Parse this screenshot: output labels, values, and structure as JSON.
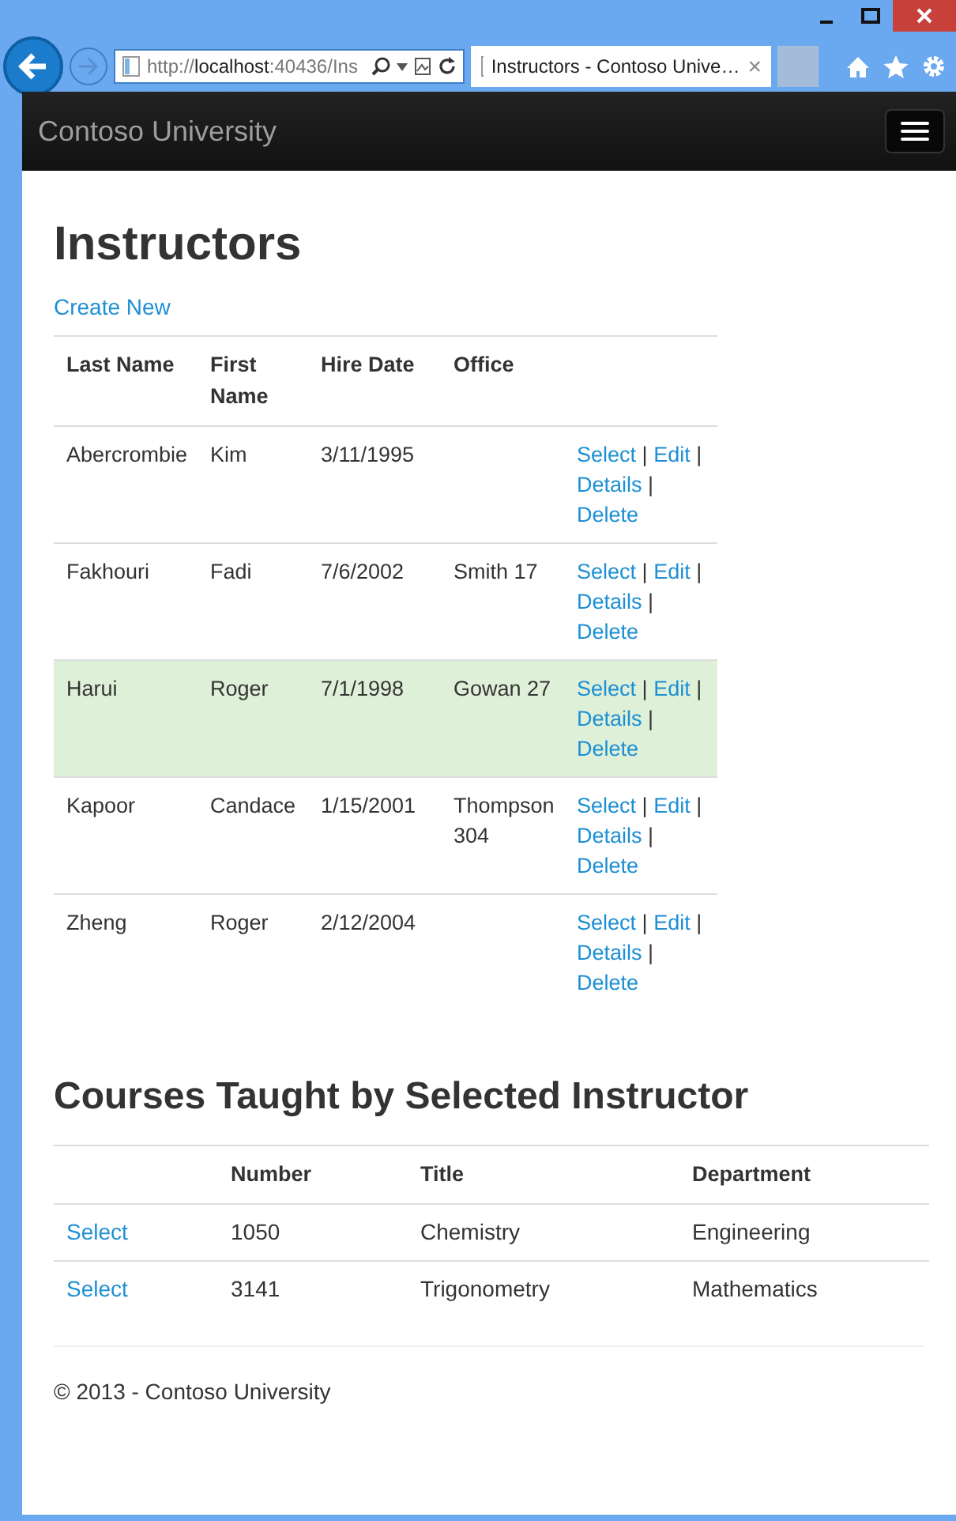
{
  "browser": {
    "address": "http://**localhost**:40436/Ins",
    "tab_title": "Instructors - Contoso Unive…",
    "tab_close": "×"
  },
  "navbar": {
    "brand": "Contoso University"
  },
  "page": {
    "title": "Instructors",
    "create_link": "Create New",
    "instructors": {
      "columns": [
        "Last Name",
        "First Name",
        "Hire Date",
        "Office"
      ],
      "separator": "|",
      "rows": [
        {
          "cells": [
            "Abercrombie",
            "Kim",
            "3/11/1995",
            ""
          ],
          "actions": [
            "Select",
            "Edit",
            "Details",
            "Delete"
          ],
          "selected": false
        },
        {
          "cells": [
            "Fakhouri",
            "Fadi",
            "7/6/2002",
            "Smith 17"
          ],
          "actions": [
            "Select",
            "Edit",
            "Details",
            "Delete"
          ],
          "selected": false
        },
        {
          "cells": [
            "Harui",
            "Roger",
            "7/1/1998",
            "Gowan 27"
          ],
          "actions": [
            "Select",
            "Edit",
            "Details",
            "Delete"
          ],
          "selected": true
        },
        {
          "cells": [
            "Kapoor",
            "Candace",
            "1/15/2001",
            "Thompson 304"
          ],
          "actions": [
            "Select",
            "Edit",
            "Details",
            "Delete"
          ],
          "selected": false
        },
        {
          "cells": [
            "Zheng",
            "Roger",
            "2/12/2004",
            ""
          ],
          "actions": [
            "Select",
            "Edit",
            "Details",
            "Delete"
          ],
          "selected": false
        }
      ]
    },
    "courses_title": "Courses Taught by Selected Instructor",
    "courses": {
      "columns": [
        "",
        "Number",
        "Title",
        "Department"
      ],
      "rows": [
        {
          "cells": [
            "Select",
            "1050",
            "Chemistry",
            "Engineering"
          ]
        },
        {
          "cells": [
            "Select",
            "3141",
            "Trigonometry",
            "Mathematics"
          ]
        }
      ]
    },
    "footer": "© 2013 - Contoso University"
  }
}
